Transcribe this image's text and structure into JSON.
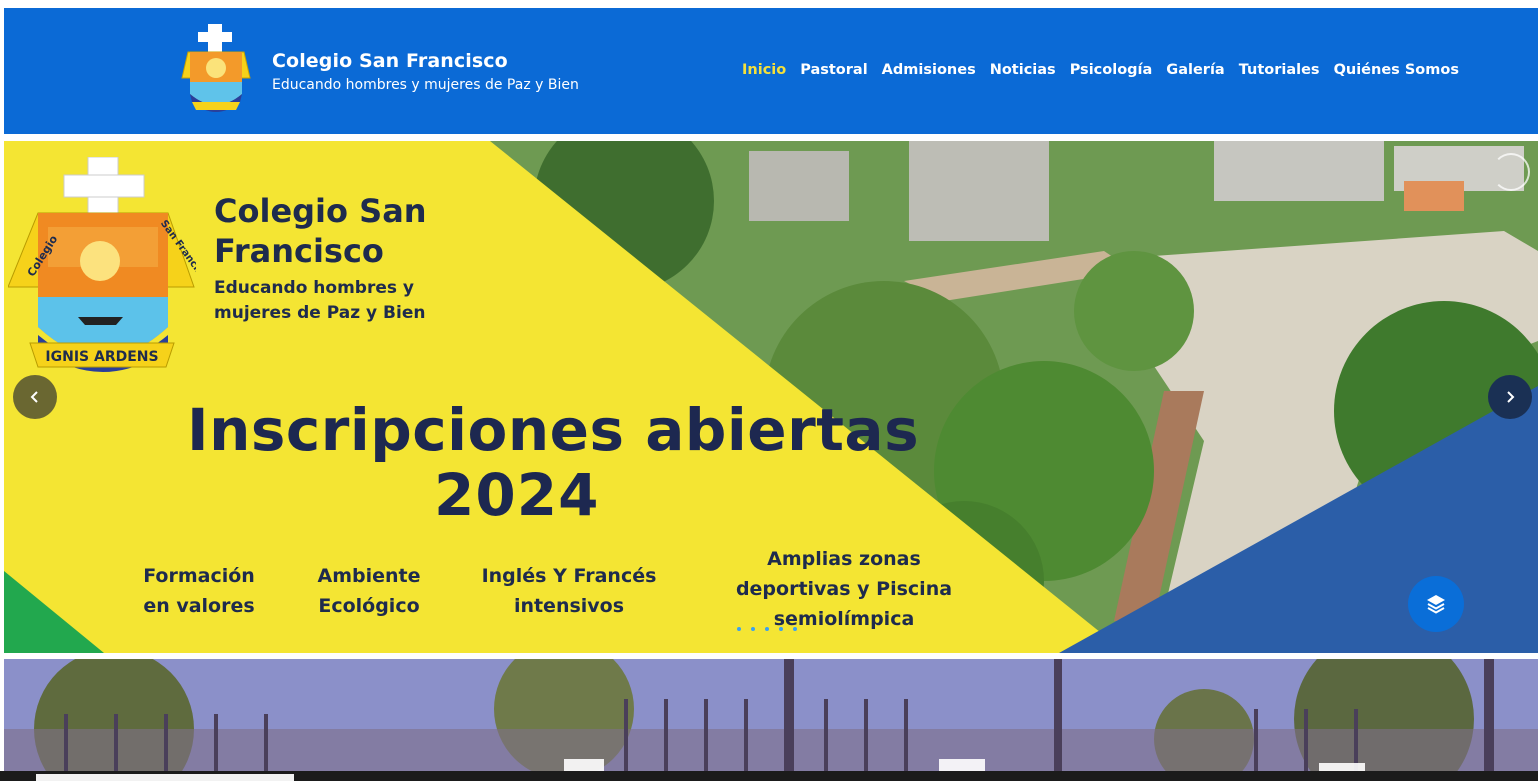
{
  "header": {
    "brand_name": "Colegio San Francisco",
    "brand_tagline": "Educando hombres y mujeres de Paz y Bien",
    "logo_icon": "school-crest-icon"
  },
  "nav": {
    "items": [
      {
        "label": "Inicio",
        "active": true
      },
      {
        "label": "Pastoral",
        "active": false
      },
      {
        "label": "Admisiones",
        "active": false
      },
      {
        "label": "Noticias",
        "active": false
      },
      {
        "label": "Psicología",
        "active": false
      },
      {
        "label": "Galería",
        "active": false
      },
      {
        "label": "Tutoriales",
        "active": false
      },
      {
        "label": "Quiénes Somos",
        "active": false
      }
    ]
  },
  "slide": {
    "title": "Colegio San Francisco",
    "subtitle": "Educando hombres y mujeres de Paz y Bien",
    "crest_motto": "IGNIS ARDENS",
    "crest_left": "Colegio",
    "crest_right": "San Francisco",
    "headline": "Inscripciones abiertas",
    "year": "2024",
    "features": [
      "Formación en valores",
      "Ambiente Ecológico",
      "Inglés Y Francés intensivos",
      "Amplias zonas deportivas y Piscina semiolímpica"
    ],
    "prev_icon": "chevron-left-icon",
    "next_icon": "chevron-right-icon",
    "layers_icon": "layers-icon",
    "slide_count": 5,
    "active_slide": 1
  },
  "colors": {
    "header_blue": "#0b6ad6",
    "nav_active": "#f4e03b",
    "slide_yellow": "#f4e533",
    "slide_text": "#1d2850",
    "corner_blue": "#2b5ea8",
    "corner_green": "#22a84e"
  }
}
